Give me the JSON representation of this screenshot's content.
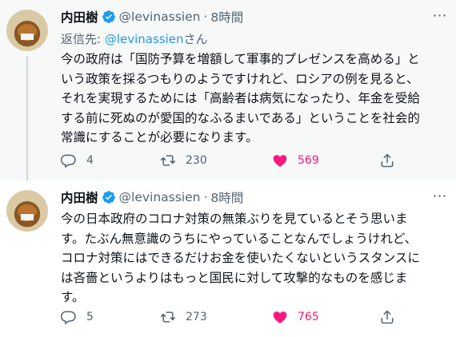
{
  "tweets": [
    {
      "author_name": "内田樹",
      "handle": "@levinassien",
      "separator": "·",
      "time": "8時間",
      "more_label": "⋯",
      "reply_prefix": "返信先: ",
      "reply_mention": "@levinassien",
      "reply_suffix": "さん",
      "lines": [
        "今の政府は「国防予算を増額して軍事的プレゼンスを高める」と",
        "いう政策を採るつもりのようですけれど、ロシアの例を見ると、",
        "それを実現するためには「高齢者は病気になったり、年金を受給",
        "する前に死ぬのが愛国的なふるまいである」ということを社会的",
        "常識にすることが必要になります。"
      ],
      "replies": "4",
      "retweets": "230",
      "likes": "569"
    },
    {
      "author_name": "内田樹",
      "handle": "@levinassien",
      "separator": "·",
      "time": "8時間",
      "more_label": "⋯",
      "lines": [
        "今の日本政府のコロナ対策の無策ぶりを見ているとそう思いま",
        "す。たぶん無意識のうちにやっていることなんでしょうけれど、",
        "コロナ対策にはできるだけお金を使いたくないというスタンスに",
        "は吝嗇というよりはもっと国民に対して攻撃的なものを感じま",
        "す。"
      ],
      "replies": "5",
      "retweets": "273",
      "likes": "765"
    }
  ],
  "colors": {
    "accent": "#1d9bf0",
    "like": "#f91880",
    "muted": "#536471",
    "highlight_bg": "#f7f9f9"
  },
  "icons": [
    "verified-icon",
    "more-icon",
    "reply-icon",
    "retweet-icon",
    "like-icon",
    "share-icon"
  ]
}
